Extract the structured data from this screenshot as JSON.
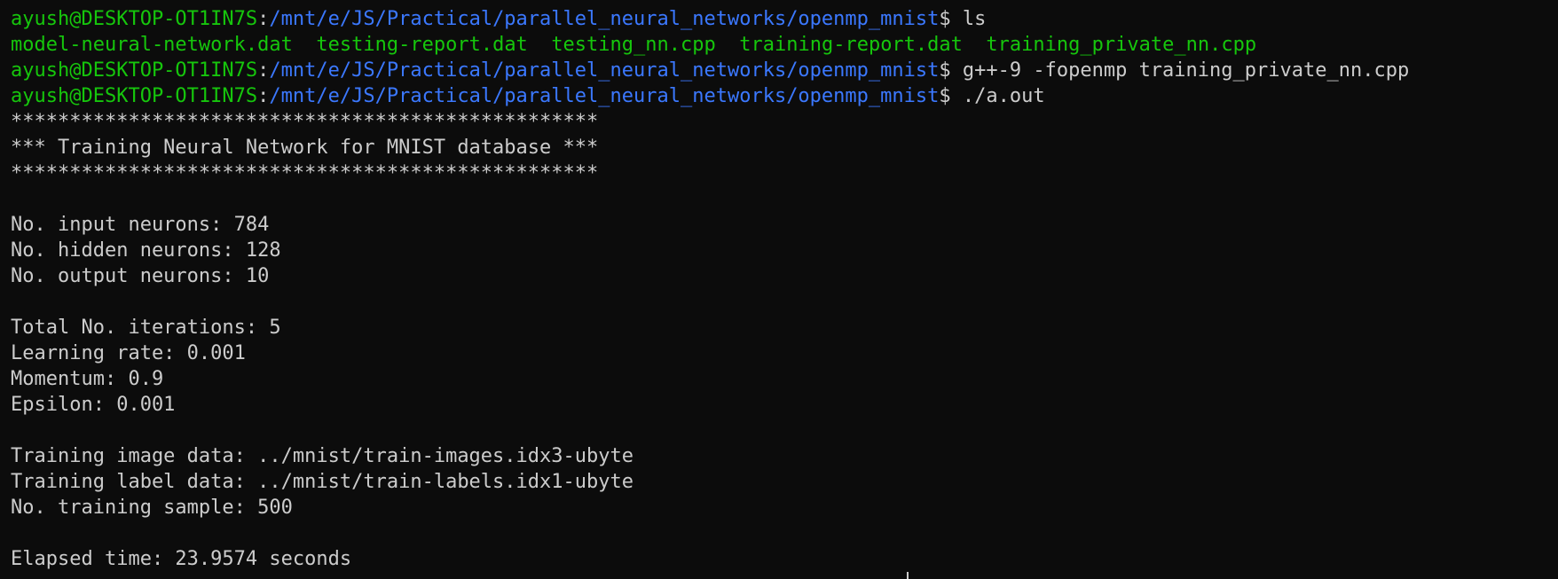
{
  "terminal": {
    "prompt": {
      "user_host": "ayush@DESKTOP-OT1IN7S",
      "separator": ":",
      "path": "/mnt/e/JS/Practical/parallel_neural_networks/openmp_mnist",
      "symbol": "$"
    },
    "commands": {
      "ls": " ls",
      "compile": " g++-9 -fopenmp training_private_nn.cpp",
      "run": " ./a.out"
    },
    "ls_output": [
      "model-neural-network.dat",
      "testing-report.dat",
      "testing_nn.cpp",
      "training-report.dat",
      "training_private_nn.cpp"
    ],
    "banner": {
      "stars": "**************************************************",
      "title": "*** Training Neural Network for MNIST database ***"
    },
    "network": {
      "input": "No. input neurons: 784",
      "hidden": "No. hidden neurons: 128",
      "output": "No. output neurons: 10"
    },
    "params": {
      "iterations": "Total No. iterations: 5",
      "learning_rate": "Learning rate: 0.001",
      "momentum": "Momentum: 0.9",
      "epsilon": "Epsilon: 0.001"
    },
    "data": {
      "image": "Training image data: ../mnist/train-images.idx3-ubyte",
      "label": "Training label data: ../mnist/train-labels.idx1-ubyte",
      "samples": "No. training sample: 500"
    },
    "elapsed": "Elapsed time: 23.9574 seconds",
    "colors": {
      "background": "#0c0c0c",
      "user_host": "#16c60c",
      "path": "#3b78ff",
      "text": "#cccccc",
      "files": "#16c60c"
    }
  }
}
